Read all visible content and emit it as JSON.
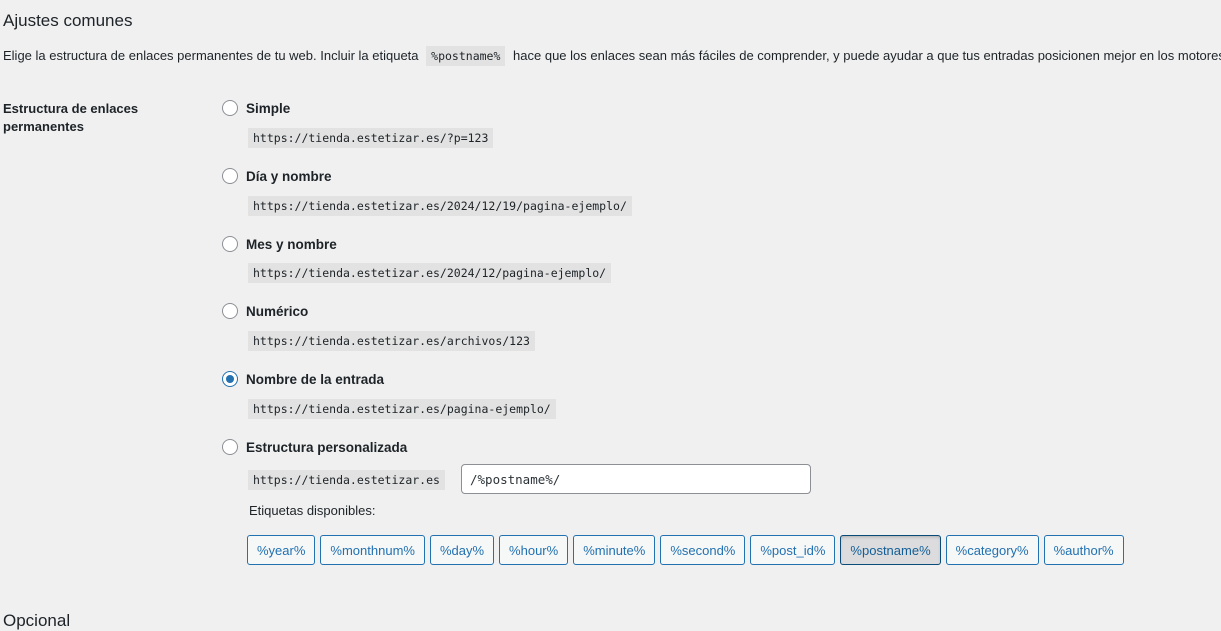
{
  "section": {
    "title": "Ajustes comunes",
    "description_before": "Elige la estructura de enlaces permanentes de tu web. Incluir la etiqueta",
    "description_tag": "%postname%",
    "description_after": "hace que los enlaces sean más fáciles de comprender, y puede ayudar a que tus entradas posicionen mejor en los motores de"
  },
  "field": {
    "label": "Estructura de enlaces permanentes"
  },
  "options": [
    {
      "label": "Simple",
      "example": "https://tienda.estetizar.es/?p=123",
      "checked": false
    },
    {
      "label": "Día y nombre",
      "example": "https://tienda.estetizar.es/2024/12/19/pagina-ejemplo/",
      "checked": false
    },
    {
      "label": "Mes y nombre",
      "example": "https://tienda.estetizar.es/2024/12/pagina-ejemplo/",
      "checked": false
    },
    {
      "label": "Numérico",
      "example": "https://tienda.estetizar.es/archivos/123",
      "checked": false
    },
    {
      "label": "Nombre de la entrada",
      "example": "https://tienda.estetizar.es/pagina-ejemplo/",
      "checked": true
    },
    {
      "label": "Estructura personalizada",
      "checked": false
    }
  ],
  "custom": {
    "base": "https://tienda.estetizar.es",
    "value": "/%postname%/"
  },
  "tags": {
    "label": "Etiquetas disponibles:",
    "items": [
      "%year%",
      "%monthnum%",
      "%day%",
      "%hour%",
      "%minute%",
      "%second%",
      "%post_id%",
      "%postname%",
      "%category%",
      "%author%"
    ],
    "active": "%postname%"
  },
  "next_section": {
    "title": "Opcional"
  },
  "colors": {
    "accent": "#2271b1",
    "background": "#f0f0f1"
  }
}
